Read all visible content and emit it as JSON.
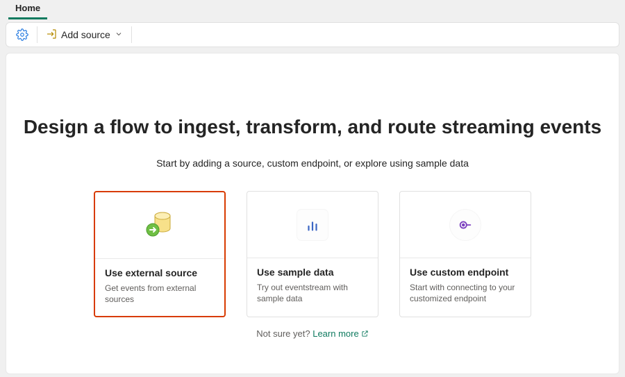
{
  "tabs": {
    "home": "Home"
  },
  "ribbon": {
    "settings_label": "Settings",
    "add_source_label": "Add source"
  },
  "main": {
    "headline": "Design a flow to ingest, transform, and route streaming events",
    "subhead": "Start by adding a source, custom endpoint, or explore using sample data",
    "cards": [
      {
        "title": "Use external source",
        "desc": "Get events from external sources"
      },
      {
        "title": "Use sample data",
        "desc": "Try out eventstream with sample data"
      },
      {
        "title": "Use custom endpoint",
        "desc": "Start with connecting to your customized endpoint"
      }
    ],
    "learn_prefix": "Not sure yet? ",
    "learn_link": "Learn more"
  },
  "colors": {
    "accent": "#0e7a5f",
    "highlight": "#d83b01"
  }
}
